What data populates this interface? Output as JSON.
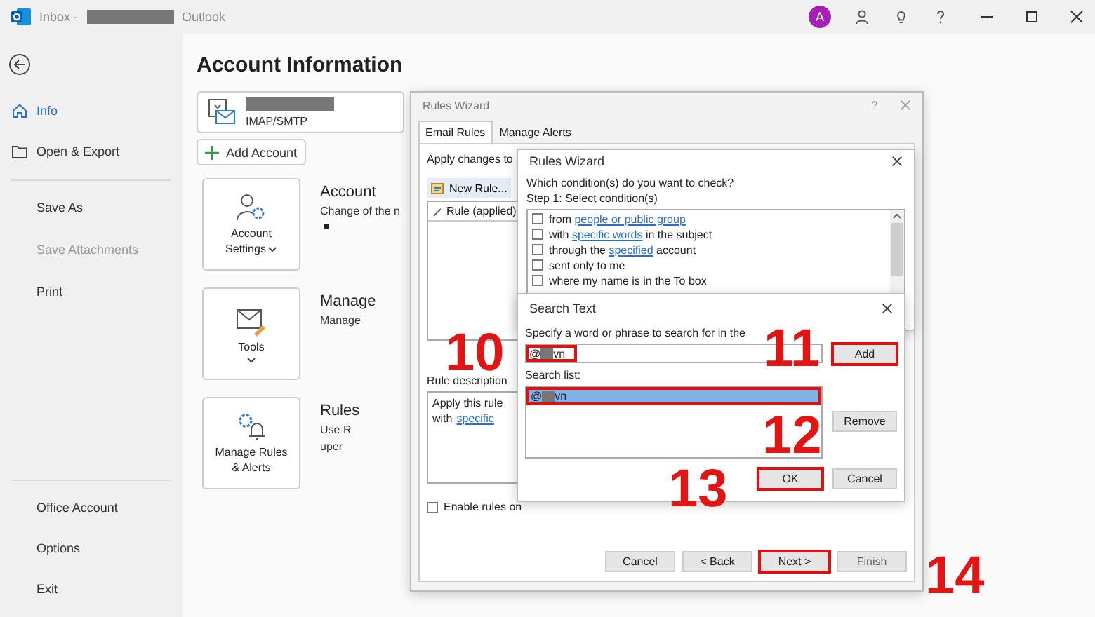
{
  "window": {
    "title_prefix": "Inbox -",
    "title_suffix": "Outlook",
    "avatar": "A"
  },
  "sidebar": {
    "groups": [
      [
        {
          "label": "Info",
          "kind": "home",
          "selected": true,
          "disabled": false
        },
        {
          "label": "Open & Export",
          "kind": "folder",
          "selected": false,
          "disabled": false
        }
      ],
      [
        {
          "label": "Save As",
          "kind": "plain",
          "selected": false,
          "disabled": false
        },
        {
          "label": "Save Attachments",
          "kind": "plain",
          "selected": false,
          "disabled": true
        },
        {
          "label": "Print",
          "kind": "plain",
          "selected": false,
          "disabled": false
        }
      ],
      [
        {
          "label": "Office Account",
          "kind": "plain",
          "selected": false,
          "disabled": false
        },
        {
          "label": "Options",
          "kind": "plain",
          "selected": false,
          "disabled": false
        },
        {
          "label": "Exit",
          "kind": "plain",
          "selected": false,
          "disabled": false
        }
      ]
    ]
  },
  "main": {
    "heading": "Account Information",
    "account_type": "IMAP/SMTP",
    "add_account": "Add Account",
    "cards": [
      {
        "kind": "account",
        "button_lines": [
          "Account",
          "Settings"
        ],
        "caret": true,
        "title": "Account",
        "lines": [
          "Change of the n"
        ],
        "bullet": true
      },
      {
        "kind": "tools",
        "button_lines": [
          "Tools"
        ],
        "caret": true,
        "title": "Manage",
        "lines": [
          "Manage"
        ],
        "bullet": false
      },
      {
        "kind": "rules",
        "button_lines": [
          "Manage Rules",
          "& Alerts"
        ],
        "caret": false,
        "title": "Rules",
        "lines": [
          "Use R",
          "uper"
        ],
        "bullet": false
      }
    ]
  },
  "rules_wizard": {
    "title": "Rules Wizard",
    "tabs": [
      {
        "label": "Email Rules",
        "selected": true
      },
      {
        "label": "Manage Alerts",
        "selected": false
      }
    ],
    "apply_label": "Apply changes to",
    "new_rule": "New Rule...",
    "list_header": "Rule (applied)",
    "description_label": "Rule description",
    "description_line": "Apply this rule",
    "description_prefix": "with",
    "description_link": "specific",
    "enable": {
      "label": "Enable rules on",
      "checked": false
    },
    "buttons": [
      {
        "label": "Cancel",
        "highlighted": false,
        "disabled": false
      },
      {
        "label": "< Back",
        "highlighted": false,
        "disabled": false
      },
      {
        "label": "Next >",
        "highlighted": true,
        "disabled": false
      },
      {
        "label": "Finish",
        "highlighted": false,
        "disabled": true
      }
    ]
  },
  "conditions_dialog": {
    "title": "Rules Wizard",
    "question": "Which condition(s) do you want to check?",
    "step": "Step 1: Select condition(s)",
    "conditions": [
      {
        "checked": false,
        "parts": [
          {
            "text": "from",
            "link": false
          },
          {
            "text": "people or public group",
            "link": true
          }
        ]
      },
      {
        "checked": false,
        "parts": [
          {
            "text": "with",
            "link": false
          },
          {
            "text": "specific words",
            "link": true
          },
          {
            "text": "in the subject",
            "link": false
          }
        ]
      },
      {
        "checked": false,
        "parts": [
          {
            "text": "through the",
            "link": false
          },
          {
            "text": "specified",
            "link": true
          },
          {
            "text": "account",
            "link": false
          }
        ]
      },
      {
        "checked": false,
        "parts": [
          {
            "text": "sent only to me",
            "link": false
          }
        ]
      },
      {
        "checked": false,
        "parts": [
          {
            "text": "where my name is in the To box",
            "link": false
          }
        ]
      }
    ]
  },
  "search_dialog": {
    "title": "Search Text",
    "instruction": "Specify a word or phrase to search for in the",
    "input": {
      "prefix": "@",
      "suffix": "vn",
      "highlighted": true
    },
    "add": {
      "label": "Add",
      "highlighted": true
    },
    "list_label": "Search list:",
    "items": [
      {
        "prefix": "@",
        "suffix": "vn",
        "selected": true,
        "highlighted": true
      }
    ],
    "remove": {
      "label": "Remove",
      "highlighted": false
    },
    "ok": {
      "label": "OK",
      "highlighted": true
    },
    "cancel": {
      "label": "Cancel",
      "highlighted": false
    }
  },
  "annotations": [
    "10",
    "11",
    "12",
    "13",
    "14"
  ]
}
